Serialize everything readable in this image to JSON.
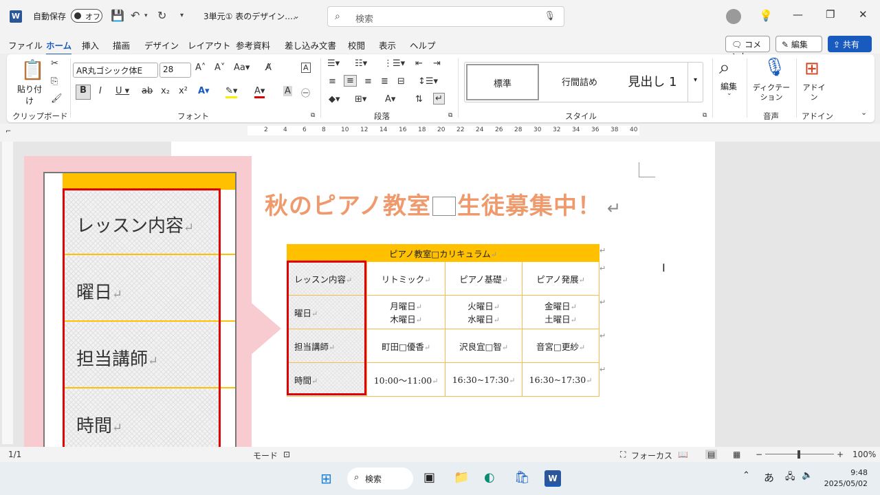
{
  "titlebar": {
    "app_icon": "W",
    "autosave_label": "自動保存",
    "autosave_state": "オフ",
    "doc_title": "3単元① 表のデザイン.…",
    "search_placeholder": "検索"
  },
  "menu": {
    "tabs": [
      "ファイル",
      "ホーム",
      "挿入",
      "描画",
      "デザイン",
      "レイアウト",
      "参考資料",
      "差し込み文書",
      "校閲",
      "表示",
      "ヘルプ"
    ],
    "active": "ホーム",
    "comment_btn": "コメント",
    "edit_btn": "編集",
    "share_btn": "共有"
  },
  "ribbon": {
    "clipboard": {
      "paste": "貼り付け",
      "label": "クリップボード"
    },
    "font": {
      "name": "AR丸ゴシック体E",
      "size": "28",
      "label": "フォント"
    },
    "paragraph": {
      "label": "段落"
    },
    "styles": {
      "items": [
        "標準",
        "行間詰め",
        "見出し 1"
      ],
      "label": "スタイル"
    },
    "edit": {
      "label": "編集"
    },
    "voice": {
      "dictate": "ディクテーション",
      "label": "音声"
    },
    "addin": {
      "name": "アドイン",
      "label": "アドイン"
    }
  },
  "ruler": {
    "marks": [
      "2",
      "4",
      "6",
      "8",
      "10",
      "12",
      "14",
      "16",
      "18",
      "20",
      "22",
      "24",
      "26",
      "28",
      "30",
      "32",
      "34",
      "36",
      "38",
      "40"
    ]
  },
  "document": {
    "headline_a": "秋のピアノ教室",
    "headline_b": "生徒募集中！",
    "table": {
      "header": "ピアノ教室□カリキュラム",
      "rows": [
        {
          "label": "レッスン内容",
          "c1": "リトミック",
          "c2": "ピアノ基礎",
          "c3": "ピアノ発展"
        },
        {
          "label": "曜日",
          "c1a": "月曜日",
          "c1b": "木曜日",
          "c2a": "火曜日",
          "c2b": "水曜日",
          "c3a": "金曜日",
          "c3b": "土曜日"
        },
        {
          "label": "担当講師",
          "c1": "町田□優香",
          "c2": "沢良宜□智",
          "c3": "音宮□更紗"
        },
        {
          "label": "時間",
          "c1": "10:00～11:00",
          "c2": "16:30~17:30",
          "c3": "16:30~17:30"
        }
      ]
    }
  },
  "zoom": {
    "labels": [
      "レッスン内容",
      "曜日",
      "担当講師",
      "時間"
    ]
  },
  "statusbar": {
    "page": "1/1",
    "mode": "モード",
    "focus": "フォーカス",
    "zoom": "100%"
  },
  "taskbar": {
    "search": "検索",
    "time": "9:48",
    "date": "2025/05/02",
    "ime": "あ"
  },
  "colors": {
    "accent": "#185abd",
    "table_header": "#ffc000",
    "highlight_border": "#e00000",
    "headline": "#ef9a6c",
    "callout": "#f8cbd1"
  }
}
